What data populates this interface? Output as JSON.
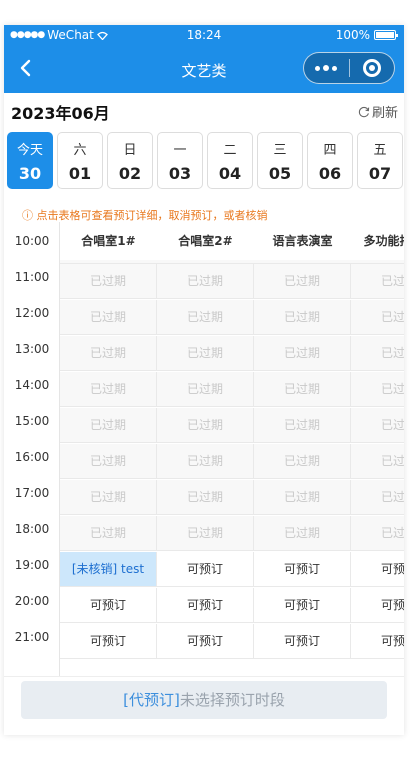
{
  "status_bar": {
    "carrier": "WeChat",
    "time": "18:24",
    "battery": "100%"
  },
  "nav": {
    "title": "文艺类"
  },
  "header": {
    "month": "2023年06月",
    "refresh_label": "刷新"
  },
  "days": [
    {
      "weekday": "今天",
      "date": "30",
      "active": true
    },
    {
      "weekday": "六",
      "date": "01",
      "active": false
    },
    {
      "weekday": "日",
      "date": "02",
      "active": false
    },
    {
      "weekday": "一",
      "date": "03",
      "active": false
    },
    {
      "weekday": "二",
      "date": "04",
      "active": false
    },
    {
      "weekday": "三",
      "date": "05",
      "active": false
    },
    {
      "weekday": "四",
      "date": "06",
      "active": false
    },
    {
      "weekday": "五",
      "date": "07",
      "active": false
    }
  ],
  "hint": "ⓘ 点击表格可查看预订详细，取消预订，或者核销",
  "rooms": [
    "合唱室1#",
    "合唱室2#",
    "语言表演室",
    "多功能排练室"
  ],
  "times": [
    "10:00",
    "11:00",
    "12:00",
    "13:00",
    "14:00",
    "15:00",
    "16:00",
    "17:00",
    "18:00",
    "19:00",
    "20:00",
    "21:00"
  ],
  "slot_labels": {
    "expired": "已过期",
    "available": "可预订"
  },
  "rows": [
    [
      {
        "text": "已过期",
        "state": "expired"
      },
      {
        "text": "已过期",
        "state": "expired"
      },
      {
        "text": "已过期",
        "state": "expired"
      },
      {
        "text": "已过期",
        "state": "expired"
      }
    ],
    [
      {
        "text": "已过期",
        "state": "expired"
      },
      {
        "text": "已过期",
        "state": "expired"
      },
      {
        "text": "已过期",
        "state": "expired"
      },
      {
        "text": "已过期",
        "state": "expired"
      }
    ],
    [
      {
        "text": "已过期",
        "state": "expired"
      },
      {
        "text": "已过期",
        "state": "expired"
      },
      {
        "text": "已过期",
        "state": "expired"
      },
      {
        "text": "已过期",
        "state": "expired"
      }
    ],
    [
      {
        "text": "已过期",
        "state": "expired"
      },
      {
        "text": "已过期",
        "state": "expired"
      },
      {
        "text": "已过期",
        "state": "expired"
      },
      {
        "text": "已过期",
        "state": "expired"
      }
    ],
    [
      {
        "text": "已过期",
        "state": "expired"
      },
      {
        "text": "已过期",
        "state": "expired"
      },
      {
        "text": "已过期",
        "state": "expired"
      },
      {
        "text": "已过期",
        "state": "expired"
      }
    ],
    [
      {
        "text": "已过期",
        "state": "expired"
      },
      {
        "text": "已过期",
        "state": "expired"
      },
      {
        "text": "已过期",
        "state": "expired"
      },
      {
        "text": "已过期",
        "state": "expired"
      }
    ],
    [
      {
        "text": "已过期",
        "state": "expired"
      },
      {
        "text": "已过期",
        "state": "expired"
      },
      {
        "text": "已过期",
        "state": "expired"
      },
      {
        "text": "已过期",
        "state": "expired"
      }
    ],
    [
      {
        "text": "已过期",
        "state": "expired"
      },
      {
        "text": "已过期",
        "state": "expired"
      },
      {
        "text": "已过期",
        "state": "expired"
      },
      {
        "text": "已过期",
        "state": "expired"
      }
    ],
    [
      {
        "text": "[未核销] test",
        "state": "booked"
      },
      {
        "text": "可预订",
        "state": "available"
      },
      {
        "text": "可预订",
        "state": "available"
      },
      {
        "text": "可预订",
        "state": "available"
      }
    ],
    [
      {
        "text": "可预订",
        "state": "available"
      },
      {
        "text": "可预订",
        "state": "available"
      },
      {
        "text": "可预订",
        "state": "available"
      },
      {
        "text": "可预订",
        "state": "available"
      }
    ],
    [
      {
        "text": "可预订",
        "state": "available"
      },
      {
        "text": "可预订",
        "state": "available"
      },
      {
        "text": "可预订",
        "state": "available"
      },
      {
        "text": "可预订",
        "state": "available"
      }
    ]
  ],
  "footer": {
    "tag": "[代预订]",
    "text": "未选择预订时段"
  },
  "colors": {
    "primary": "#1d8ee8",
    "warning": "#e8781e",
    "booked_bg": "#cde7fb"
  }
}
